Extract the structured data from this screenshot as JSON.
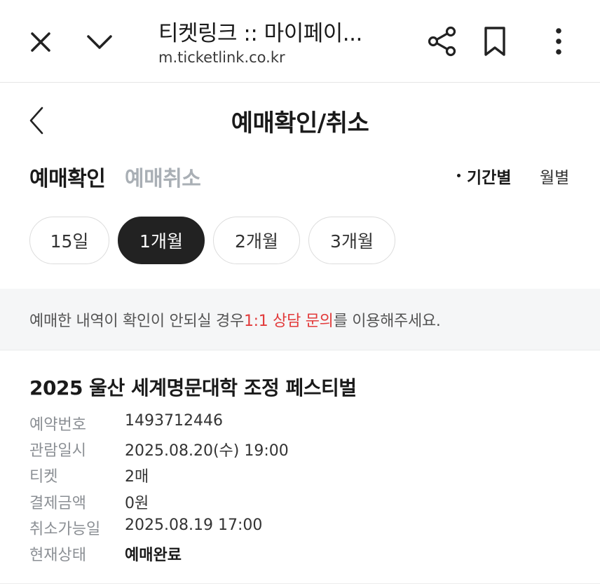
{
  "browser": {
    "title": "티켓링크 :: 마이페이...",
    "url": "m.ticketlink.co.kr",
    "icons": [
      "close-icon",
      "chevron-down-icon",
      "share-icon",
      "bookmark-icon",
      "more-vert-icon"
    ]
  },
  "page": {
    "title": "예매확인/취소",
    "back_icon": "chevron-left-icon"
  },
  "tabs": {
    "confirm": "예매확인",
    "cancel": "예매취소"
  },
  "period": {
    "by_range": "기간별",
    "by_month": "월별"
  },
  "ranges": [
    {
      "label": "15일",
      "active": false
    },
    {
      "label": "1개월",
      "active": true
    },
    {
      "label": "2개월",
      "active": false
    },
    {
      "label": "3개월",
      "active": false
    }
  ],
  "notice": {
    "before": "예매한 내역이 확인이 안되실 경우 ",
    "link": "1:1 상담 문의",
    "after": "를 이용해주세요."
  },
  "booking": {
    "title": "2025 울산 세계명문대학 조정 페스티벌",
    "rows": [
      {
        "label": "예약번호",
        "value": "1493712446"
      },
      {
        "label": "관람일시",
        "value": "2025.08.20(수) 19:00"
      },
      {
        "label": "티켓",
        "value": "2매"
      },
      {
        "label": "결제금액",
        "value": "0원"
      },
      {
        "label": "취소가능일",
        "value": "2025.08.19 17:00"
      },
      {
        "label": "현재상태",
        "value": "예매완료"
      }
    ]
  },
  "colors": {
    "accent_link": "#e23b3b",
    "chip_active": "#222222",
    "inactive_tab": "#a9afb5",
    "notice_bg": "#f5f6f7"
  }
}
